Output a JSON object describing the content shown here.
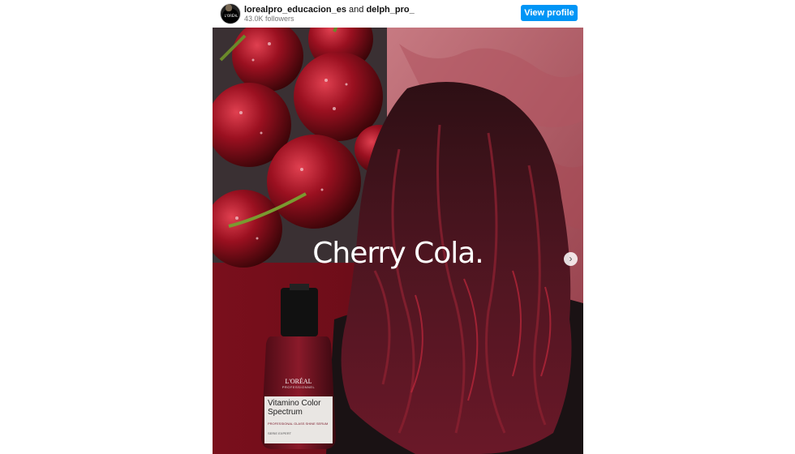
{
  "header": {
    "username_primary": "lorealpro_educacion_es",
    "joiner": "and",
    "username_secondary": "delph_pro_",
    "followers": "43.0K followers",
    "view_profile_label": "View profile",
    "avatar_text": "L'ORÉAL"
  },
  "post": {
    "headline": "Cherry Cola.",
    "product": {
      "brand": "L'ORÉAL",
      "brand_sub": "PROFESSIONNEL",
      "name_line1": "Vitamino Color",
      "name_line2": "Spectrum",
      "small_text1": "PROFESSIONAL GLASS SHINE SERUM",
      "small_text2": "SERIE EXPERT"
    },
    "next_icon": "chevron-right-icon"
  },
  "colors": {
    "accent": "#0095f6",
    "hair": "#4a1520",
    "cherry": "#8e0f1c",
    "background_pink": "#b45a64"
  }
}
